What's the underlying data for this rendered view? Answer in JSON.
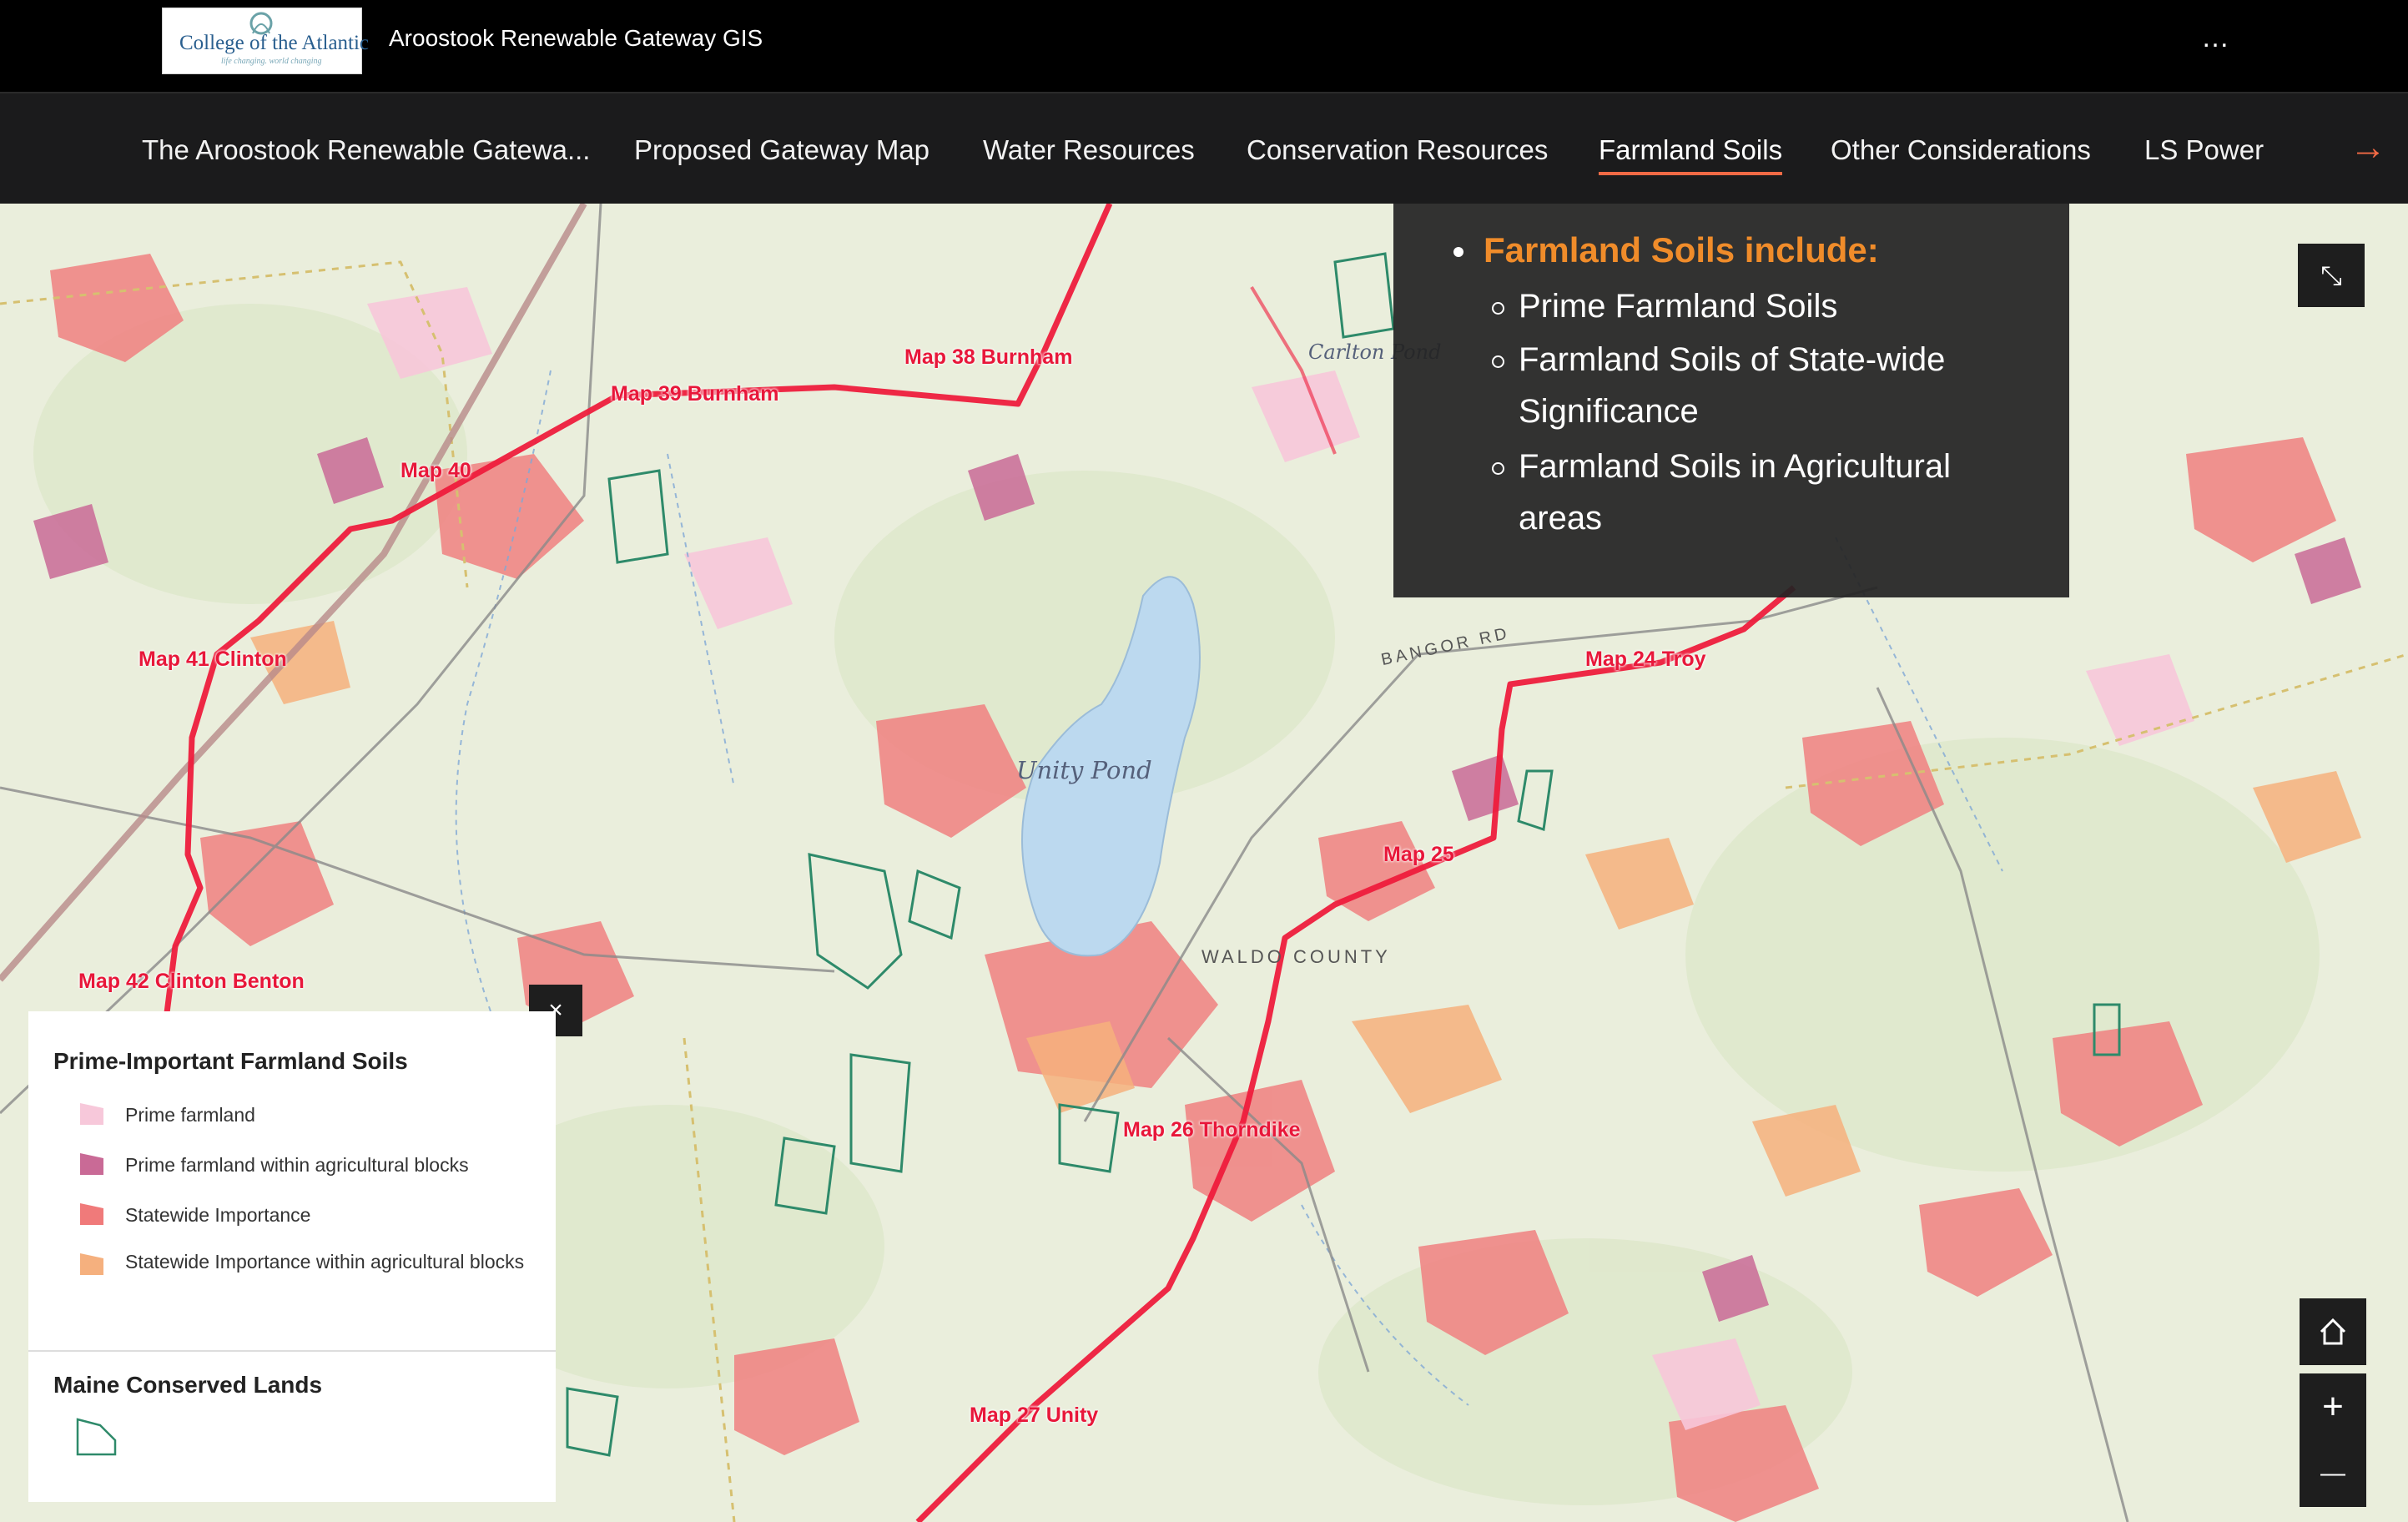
{
  "header": {
    "logo_text": "College of the Atlantic",
    "logo_tagline": "life changing. world changing",
    "app_title": "Aroostook Renewable Gateway GIS",
    "more_icon": "…"
  },
  "nav": {
    "tabs": [
      {
        "label": "The Aroostook Renewable Gatewa..."
      },
      {
        "label": "Proposed Gateway Map"
      },
      {
        "label": "Water Resources"
      },
      {
        "label": "Conservation Resources"
      },
      {
        "label": "Farmland Soils"
      },
      {
        "label": "Other Considerations"
      },
      {
        "label": "LS Power"
      }
    ],
    "active_tab": "Farmland Soils",
    "accent": "#f26a45"
  },
  "info": {
    "heading": "Farmland Soils include:",
    "items": [
      "Prime Farmland Soils",
      "Farmland Soils of State-wide Significance",
      "Farmland Soils in Agricultural areas"
    ]
  },
  "legend": {
    "section1_title": "Prime-Important Farmland Soils",
    "items": [
      {
        "label": "Prime farmland",
        "color": "#f7c8da"
      },
      {
        "label": "Prime farmland within agricultural blocks",
        "color": "#c96a96"
      },
      {
        "label": "Statewide Importance",
        "color": "#f07a7a"
      },
      {
        "label": "Statewide Importance within agricultural blocks",
        "color": "#f5b07e"
      }
    ],
    "section2_title": "Maine Conserved Lands",
    "conserved_color": "#2e8a6a"
  },
  "map": {
    "route_labels": [
      "Map 38 Burnham",
      "Map 39 Burnham",
      "Map 40",
      "Map 41 Clinton",
      "Map 42 Clinton Benton",
      "Map 24 Troy",
      "Map 25",
      "Map 26 Thorndike",
      "Map 27 Unity"
    ],
    "place_labels": [
      "Unity Pond",
      "WALDO COUNTY",
      "BANGOR RD",
      "Carlton Pond"
    ],
    "route_color": "#ee1c3c",
    "water_color": "#bcd9ef"
  },
  "controls": {
    "home_icon": "⌂",
    "zoom_in": "+",
    "zoom_out": "—",
    "close": "×",
    "expand": "⤡"
  }
}
